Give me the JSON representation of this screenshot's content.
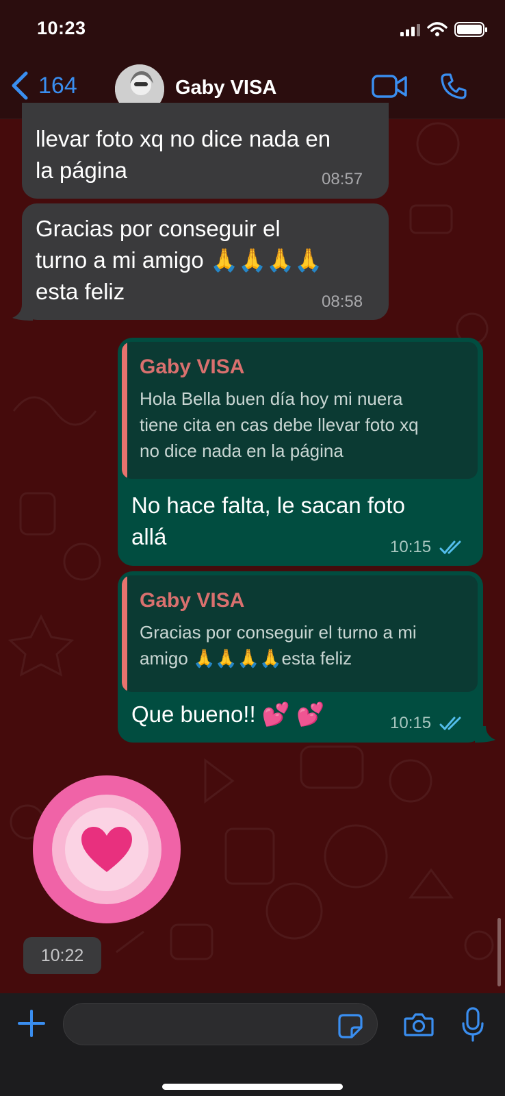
{
  "status_bar": {
    "time": "10:23"
  },
  "header": {
    "back_count": "164",
    "contact_name": "Gaby VISA"
  },
  "messages": [
    {
      "direction": "incoming",
      "lines": [
        "llevar foto xq no dice nada en",
        "la página"
      ],
      "time": "08:57"
    },
    {
      "direction": "incoming",
      "lines": [
        "Gracias por conseguir el",
        "turno a mi amigo 🙏🙏🙏🙏",
        "esta feliz"
      ],
      "time": "08:58"
    },
    {
      "direction": "outgoing",
      "quote_author": "Gaby VISA",
      "quote_lines": [
        "Hola Bella buen día hoy mi nuera",
        "tiene cita en cas debe llevar foto xq",
        "no dice nada en la página"
      ],
      "lines": [
        "No hace falta, le sacan foto",
        "allá"
      ],
      "time": "10:15",
      "status": "read"
    },
    {
      "direction": "outgoing",
      "quote_author": "Gaby VISA",
      "quote_lines": [
        "Gracias por conseguir el turno a mi",
        "amigo 🙏🙏🙏🙏esta feliz"
      ],
      "lines": [
        "Que bueno!! 💕 💕"
      ],
      "time": "10:15",
      "status": "read"
    }
  ],
  "sticker": {
    "icon": "heart-sticker",
    "time": "10:22"
  },
  "composer": {
    "placeholder": "",
    "value": ""
  },
  "colors": {
    "accent": "#3a8ef0",
    "incoming_bubble": "#3a3a3c",
    "outgoing_bubble": "#014d40",
    "quote_author": "#d9706e",
    "read_ticks": "#53bdeb",
    "sticker_pink": "#f063a7"
  }
}
